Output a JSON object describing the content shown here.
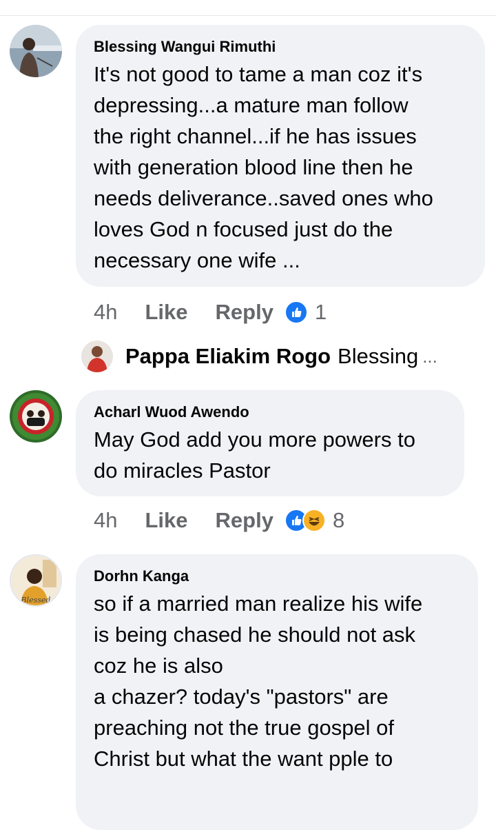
{
  "comments": [
    {
      "author": "Blessing Wangui Rimuthi",
      "text": "It's not good to tame a man coz it's\ndepressing...a mature man follow\nthe right channel...if he has issues\nwith generation blood line then he\nneeds deliverance..saved ones who\nloves God n focused just do the\nnecessary one wife ...",
      "time": "4h",
      "like_label": "Like",
      "reply_label": "Reply",
      "reaction_count": "1",
      "reactions": [
        "like-icon"
      ]
    },
    {
      "author": "Acharl Wuod Awendo",
      "text": "May God add you more powers to\ndo miracles Pastor",
      "time": "4h",
      "like_label": "Like",
      "reply_label": "Reply",
      "reaction_count": "8",
      "reactions": [
        "like-icon",
        "haha-icon"
      ]
    },
    {
      "author": "Dorhn Kanga",
      "text": "so if a married man realize his wife\nis being chased he should not ask\ncoz he is also\na chazer? today's \"pastors\" are\npreaching not the true gospel of\nChrist but what the want pple to",
      "avatar_caption": "Blessed"
    }
  ],
  "reply_preview": {
    "author": "Pappa Eliakim Rogo",
    "snippet": "Blessing",
    "ellipsis": "..."
  },
  "colors": {
    "bubble": "#f0f2f5",
    "secondary_text": "#65676b",
    "like_blue": "#1877f2",
    "haha_yellow": "#f7b125"
  }
}
